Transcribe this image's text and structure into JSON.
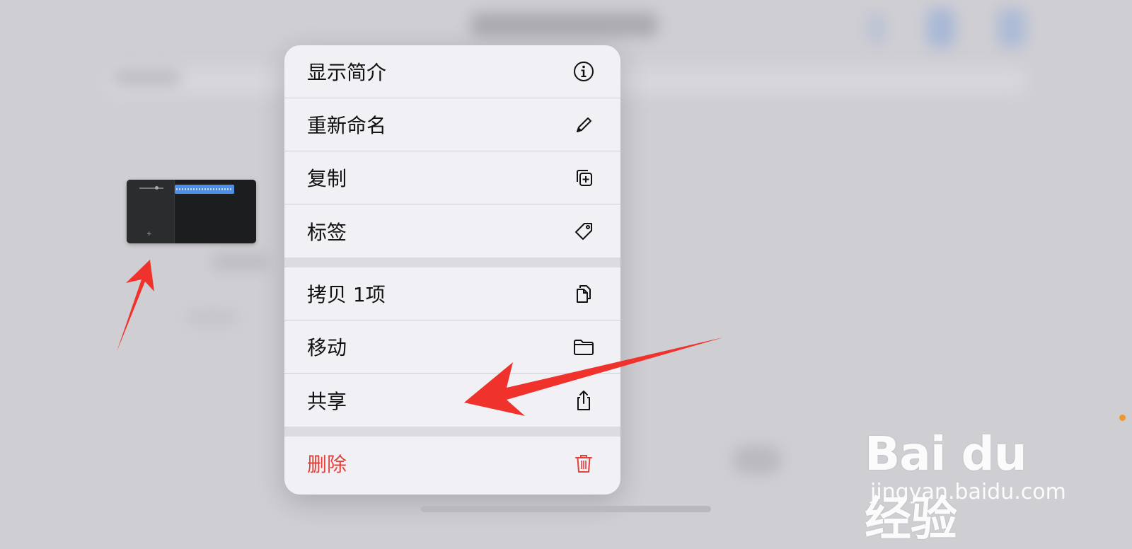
{
  "menu": {
    "items": [
      {
        "label": "显示简介",
        "icon": "info-icon"
      },
      {
        "label": "重新命名",
        "icon": "pencil-icon"
      },
      {
        "label": "复制",
        "icon": "duplicate-icon"
      },
      {
        "label": "标签",
        "icon": "tag-icon"
      },
      {
        "label": "拷贝 1项",
        "icon": "copy-icon"
      },
      {
        "label": "移动",
        "icon": "folder-icon"
      },
      {
        "label": "共享",
        "icon": "share-icon"
      },
      {
        "label": "删除",
        "icon": "trash-icon"
      }
    ]
  },
  "colors": {
    "danger": "#e4413a",
    "annotation": "#f0322c",
    "menu_background": "#f1f0f5"
  },
  "watermark": {
    "logo": "Bai du 经验",
    "url": "jingyan.baidu.com"
  }
}
